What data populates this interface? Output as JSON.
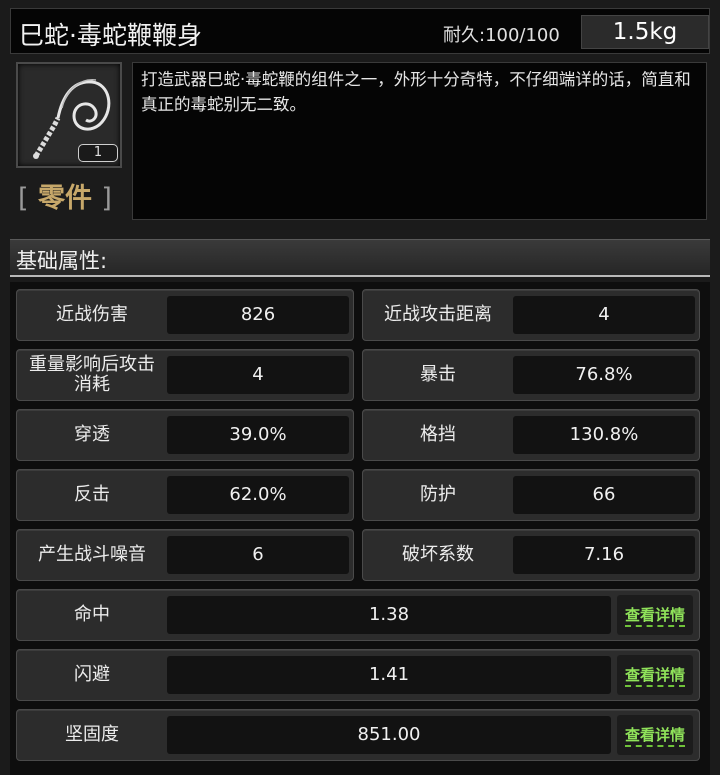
{
  "item": {
    "name": "巳蛇·毒蛇鞭鞭身",
    "durability": "耐久:100/100",
    "weight": "1.5kg",
    "count": "1",
    "icon": "whip-icon",
    "category": "零件",
    "bracket_left": "[",
    "bracket_right": "]",
    "description": "打造武器巳蛇·毒蛇鞭的组件之一，外形十分奇特，不仔细端详的话，简直和真正的毒蛇别无二致。"
  },
  "section": {
    "title": "基础属性:"
  },
  "stats": [
    {
      "label": "近战伤害",
      "value": "826"
    },
    {
      "label": "近战攻击距离",
      "value": "4"
    },
    {
      "label": "重量影响后攻击消耗",
      "value": "4"
    },
    {
      "label": "暴击",
      "value": "76.8%"
    },
    {
      "label": "穿透",
      "value": "39.0%"
    },
    {
      "label": "格挡",
      "value": "130.8%"
    },
    {
      "label": "反击",
      "value": "62.0%"
    },
    {
      "label": "防护",
      "value": "66"
    },
    {
      "label": "产生战斗噪音",
      "value": "6"
    },
    {
      "label": "破坏系数",
      "value": "7.16"
    }
  ],
  "wide_stats": [
    {
      "label": "命中",
      "value": "1.38",
      "button": "查看详情"
    },
    {
      "label": "闪避",
      "value": "1.41",
      "button": "查看详情"
    },
    {
      "label": "坚固度",
      "value": "851.00",
      "button": "查看详情"
    }
  ],
  "colors": {
    "category": "#c7a86a",
    "detail_button": "#8fe25a"
  }
}
